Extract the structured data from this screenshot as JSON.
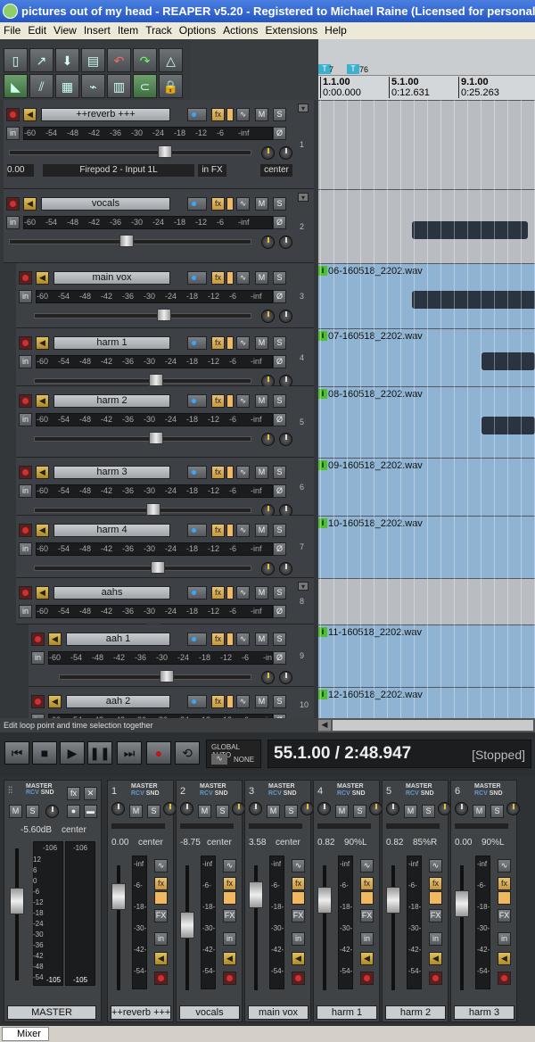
{
  "window": {
    "title": "pictures out of my head - REAPER v5.20 - Registered to Michael Raine (Licensed for personal/s"
  },
  "menu": [
    "File",
    "Edit",
    "View",
    "Insert",
    "Item",
    "Track",
    "Options",
    "Actions",
    "Extensions",
    "Help"
  ],
  "ruler": {
    "markers": [
      "7",
      "76"
    ],
    "bars": [
      {
        "bar": "1.1.00",
        "time": "0:00.000"
      },
      {
        "bar": "5.1.00",
        "time": "0:12.631"
      },
      {
        "bar": "9.1.00",
        "time": "0:25.263"
      }
    ]
  },
  "tracks": [
    {
      "num": "1",
      "name": "++reverb +++",
      "input_text": "Firepod 2 - Input 1L",
      "vol": "0.00",
      "infx": "in FX",
      "pan": "center"
    },
    {
      "num": "2",
      "name": "vocals"
    },
    {
      "num": "3",
      "name": "main vox",
      "item": "06-160518_2202.wav"
    },
    {
      "num": "4",
      "name": "harm 1",
      "item": "07-160518_2202.wav"
    },
    {
      "num": "5",
      "name": "harm 2",
      "item": "08-160518_2202.wav"
    },
    {
      "num": "6",
      "name": "harm 3",
      "item": "09-160518_2202.wav"
    },
    {
      "num": "7",
      "name": "harm 4",
      "item": "10-160518_2202.wav"
    },
    {
      "num": "8",
      "name": "aahs"
    },
    {
      "num": "9",
      "name": "aah 1",
      "item": "11-160518_2202.wav"
    },
    {
      "num": "10",
      "name": "aah 2",
      "item": "12-160518_2202.wav"
    }
  ],
  "meter_scale": [
    "-60",
    "-54",
    "-48",
    "-42",
    "-36",
    "-30",
    "-24",
    "-18",
    "-12",
    "-6",
    "-inf"
  ],
  "status": "Edit loop point and time selection together",
  "transport": {
    "global_auto": "GLOBAL AUTO",
    "none": "NONE",
    "position": "55.1.00 / 2:48.947",
    "state": "[Stopped]"
  },
  "mixer": {
    "master": {
      "label": "MASTER",
      "vol": "-5.60dB",
      "pan": "center",
      "peakL": "-106",
      "peakR": "-106",
      "bottomL": "-105",
      "bottomR": "-105"
    },
    "strips": [
      {
        "num": "1",
        "name": "++reverb +++",
        "vol": "0.00",
        "pan": "center"
      },
      {
        "num": "2",
        "name": "vocals",
        "vol": "-8.75",
        "pan": "center"
      },
      {
        "num": "3",
        "name": "main vox",
        "vol": "3.58",
        "pan": "center"
      },
      {
        "num": "4",
        "name": "harm 1",
        "vol": "0.82",
        "pan": "90%L"
      },
      {
        "num": "5",
        "name": "harm 2",
        "vol": "0.82",
        "pan": "85%R"
      },
      {
        "num": "6",
        "name": "harm 3",
        "vol": "0.00",
        "pan": "90%L"
      }
    ],
    "strip_scale": [
      "-inf",
      "-6-",
      "-18-",
      "-30-",
      "-42-",
      "-54-"
    ],
    "master_scale": [
      "12",
      "6",
      "0",
      "-6",
      "-12",
      "-18",
      "-24",
      "-30",
      "-36",
      "-42",
      "-48",
      "-54"
    ],
    "tab": "Mixer"
  }
}
